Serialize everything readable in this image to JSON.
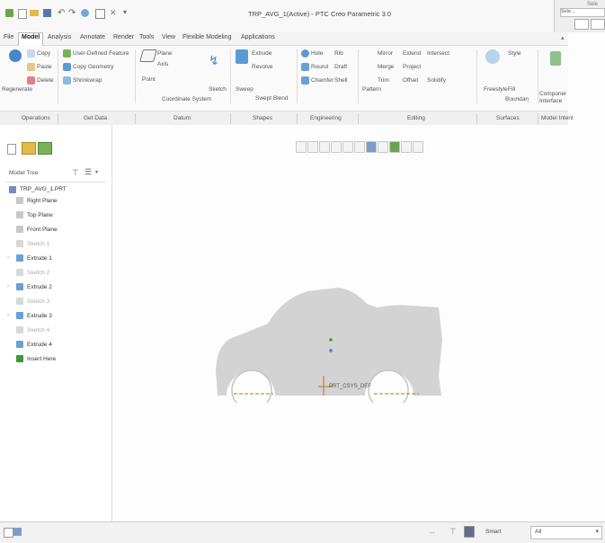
{
  "window": {
    "title": "TRP_AVG_1(Active) - PTC Creo Parametric 3.0",
    "search_label": "Sele",
    "search_value": "Sele..."
  },
  "tabs": [
    "File",
    "Model",
    "Analysis",
    "Annotate",
    "Render",
    "Tools",
    "View",
    "Flexible Modeling",
    "Applications"
  ],
  "active_tab": "Model",
  "ribbon": {
    "operations": [
      "Regenerate",
      "Copy",
      "Paste",
      "Delete"
    ],
    "get_data": [
      "User-Defined Feature",
      "Copy Geometry",
      "Shrinkwrap"
    ],
    "datum": [
      "Plane",
      "Axis",
      "Point",
      "Coordinate System",
      "Sketch"
    ],
    "shapes": [
      "Extrude",
      "Revolve",
      "Sweep",
      "Swept Blend"
    ],
    "engineering": [
      "Hole",
      "Round",
      "Chamfer",
      "Rib",
      "Draft",
      "Shell"
    ],
    "editing": [
      "Mirror",
      "Extend",
      "Project",
      "Merge",
      "Trim",
      "Offset",
      "Pattern",
      "Intersect",
      "Solidify"
    ],
    "surfaces": [
      "Freestyle",
      "Style",
      "Boundary Blend",
      "Fill"
    ],
    "model_intent": [
      "Component Interface"
    ]
  },
  "groups": [
    "Operations",
    "Get Data",
    "Datum",
    "Shapes",
    "Engineering",
    "Editing",
    "Surfaces",
    "Model Intent"
  ],
  "panel": {
    "tree_label": "Model Tree",
    "root": "TRP_AVG_1.PRT",
    "items": [
      {
        "label": "Right Plane",
        "dim": false,
        "expand": false
      },
      {
        "label": "Top Plane",
        "dim": false,
        "expand": false
      },
      {
        "label": "Front Plane",
        "dim": false,
        "expand": false
      },
      {
        "label": "Sketch 1",
        "dim": true,
        "expand": false
      },
      {
        "label": "Extrude 1",
        "dim": false,
        "expand": true
      },
      {
        "label": "Sketch 2",
        "dim": true,
        "expand": false
      },
      {
        "label": "Extrude 2",
        "dim": false,
        "expand": true
      },
      {
        "label": "Sketch 3",
        "dim": true,
        "expand": false
      },
      {
        "label": "Extrude 3",
        "dim": false,
        "expand": true
      },
      {
        "label": "Sketch 4",
        "dim": true,
        "expand": false
      },
      {
        "label": "Extrude 4",
        "dim": false,
        "expand": false
      },
      {
        "label": "Insert Here",
        "dim": false,
        "expand": false
      }
    ]
  },
  "viewport": {
    "csys_label": "PRT_CSYS_DEF",
    "body_color": "#d3d3d3",
    "axis_color": "#b0772a"
  },
  "status": {
    "filter_label": "Smart",
    "filter_value": "All"
  }
}
